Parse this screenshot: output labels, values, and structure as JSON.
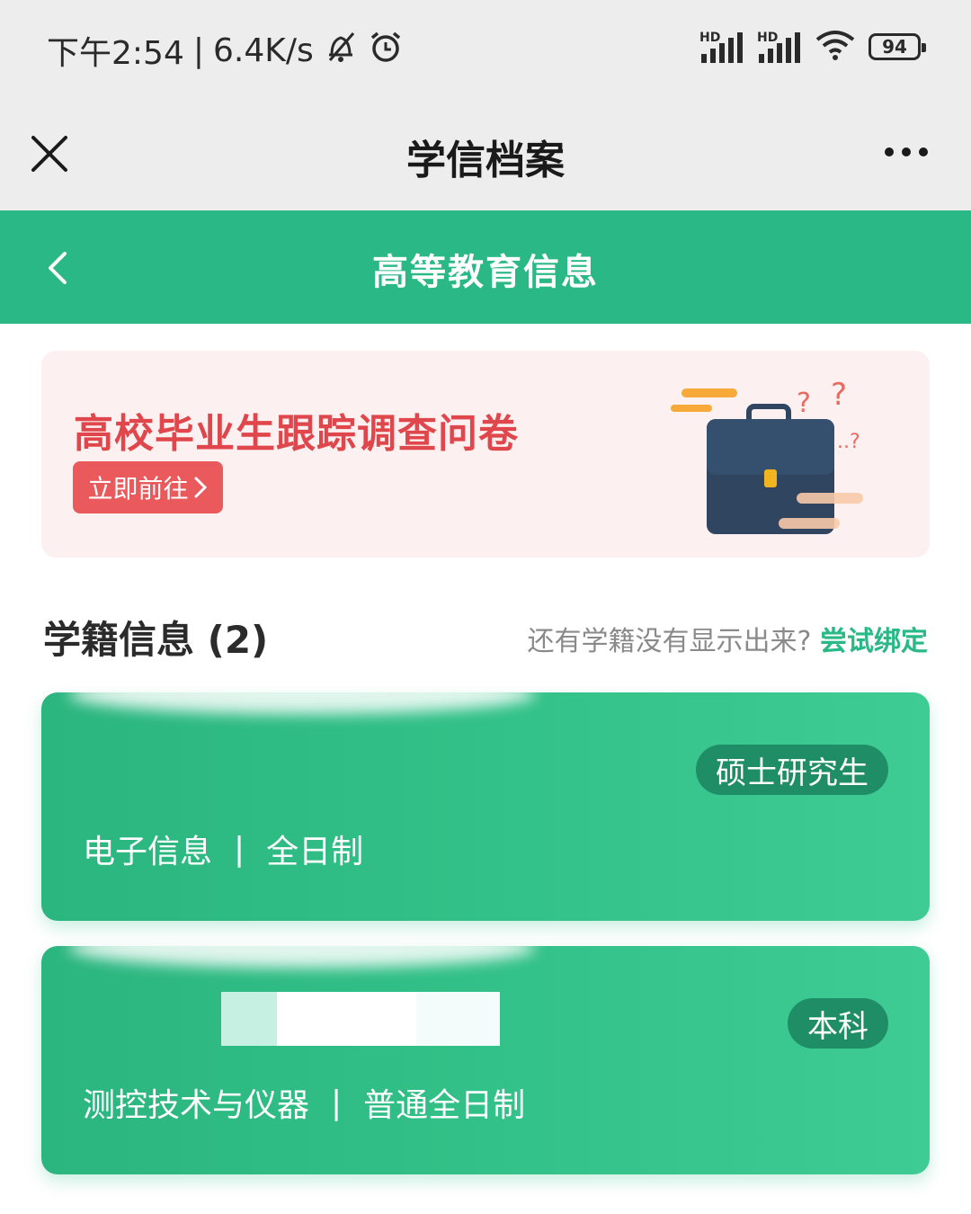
{
  "status_bar": {
    "time": "下午2:54",
    "separator": "|",
    "net_speed": "6.4K/s",
    "sim1_label": "HD",
    "sim2_label": "HD",
    "battery": "94",
    "icons": [
      "mute-bell-icon",
      "alarm-icon",
      "signal-icon",
      "wifi-icon",
      "battery-icon"
    ]
  },
  "app_header": {
    "title": "学信档案",
    "close_icon": "close-icon",
    "more_icon": "more-dots-icon"
  },
  "page_header": {
    "title": "高等教育信息",
    "back_icon": "chevron-left-icon"
  },
  "banner": {
    "title": "高校毕业生跟踪调查问卷",
    "button_label": "立即前往",
    "button_icon": "chevron-right-icon",
    "illustration": "briefcase-icon"
  },
  "section": {
    "title": "学籍信息 (2)",
    "hint": "还有学籍没有显示出来?",
    "link": "尝试绑定"
  },
  "records": [
    {
      "level": "硕士研究生",
      "major": "电子信息",
      "divider": "|",
      "mode": "全日制"
    },
    {
      "level": "本科",
      "major": "测控技术与仪器",
      "divider": "|",
      "mode": "普通全日制"
    }
  ],
  "colors": {
    "brand_green": "#29b886",
    "banner_red": "#e0474c",
    "badge_green": "#1f8e66"
  }
}
